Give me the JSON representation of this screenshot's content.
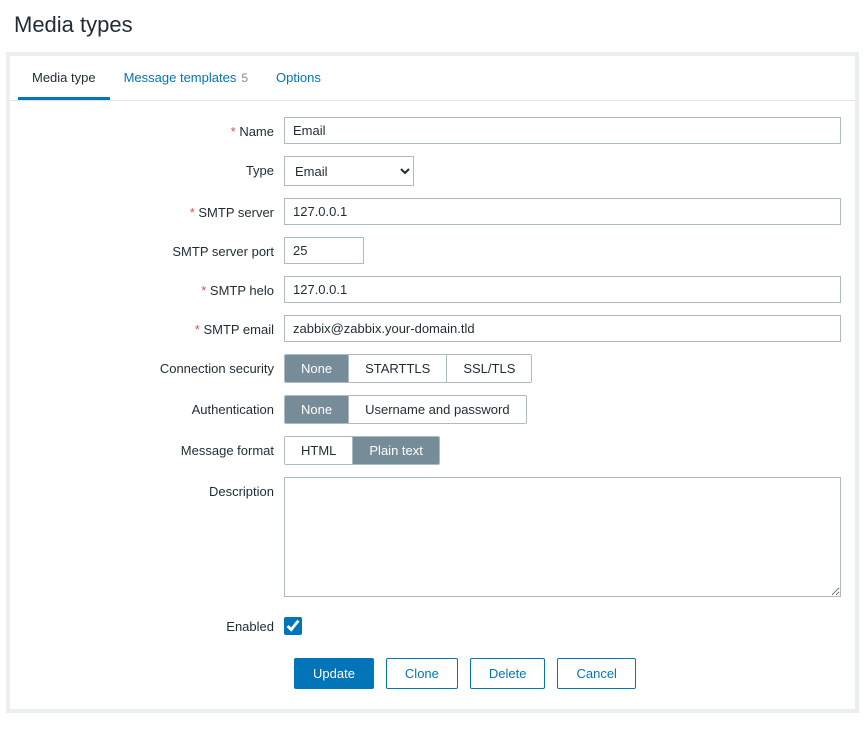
{
  "page_title": "Media types",
  "tabs": [
    {
      "label": "Media type",
      "active": true
    },
    {
      "label": "Message templates",
      "count": "5",
      "active": false
    },
    {
      "label": "Options",
      "active": false
    }
  ],
  "labels": {
    "name": "Name",
    "type": "Type",
    "smtp_server": "SMTP server",
    "smtp_port": "SMTP server port",
    "smtp_helo": "SMTP helo",
    "smtp_email": "SMTP email",
    "conn_security": "Connection security",
    "authentication": "Authentication",
    "message_format": "Message format",
    "description": "Description",
    "enabled": "Enabled"
  },
  "values": {
    "name": "Email",
    "type_selected": "Email",
    "smtp_server": "127.0.0.1",
    "smtp_port": "25",
    "smtp_helo": "127.0.0.1",
    "smtp_email": "zabbix@zabbix.your-domain.tld",
    "description": "",
    "enabled": true
  },
  "segments": {
    "conn_security": [
      "None",
      "STARTTLS",
      "SSL/TLS"
    ],
    "conn_security_selected": 0,
    "authentication": [
      "None",
      "Username and password"
    ],
    "authentication_selected": 0,
    "message_format": [
      "HTML",
      "Plain text"
    ],
    "message_format_selected": 1
  },
  "actions": {
    "update": "Update",
    "clone": "Clone",
    "delete": "Delete",
    "cancel": "Cancel"
  }
}
